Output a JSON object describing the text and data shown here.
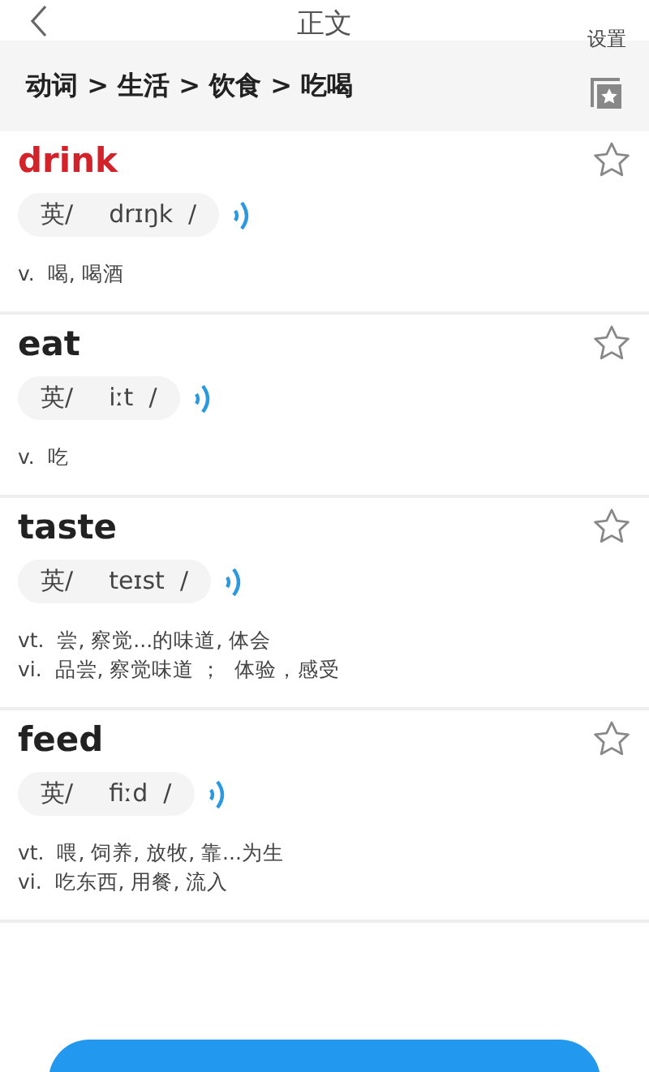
{
  "header": {
    "title": "正文",
    "settings": "设置"
  },
  "breadcrumb": "动词 > 生活 > 饮食 > 吃喝",
  "words": [
    {
      "word": "drink",
      "selected": true,
      "accent": "英/",
      "phonetic": "drɪŋk",
      "slash": "/",
      "starred": false,
      "senses": [
        "v.  喝, 喝酒"
      ]
    },
    {
      "word": "eat",
      "selected": false,
      "accent": "英/",
      "phonetic": "iːt",
      "slash": "/",
      "starred": false,
      "senses": [
        "v.  吃"
      ]
    },
    {
      "word": "taste",
      "selected": false,
      "accent": "英/",
      "phonetic": "teɪst",
      "slash": "/",
      "starred": false,
      "senses": [
        "vt.  尝, 察觉...的味道, 体会",
        "vi.  品尝, 察觉味道 ；  体验，感受"
      ]
    },
    {
      "word": "feed",
      "selected": false,
      "accent": "英/",
      "phonetic": "fiːd",
      "slash": "/",
      "starred": false,
      "senses": [
        "vt.  喂, 饲养, 放牧, 靠...为生",
        "vi.  吃东西, 用餐, 流入"
      ]
    }
  ]
}
